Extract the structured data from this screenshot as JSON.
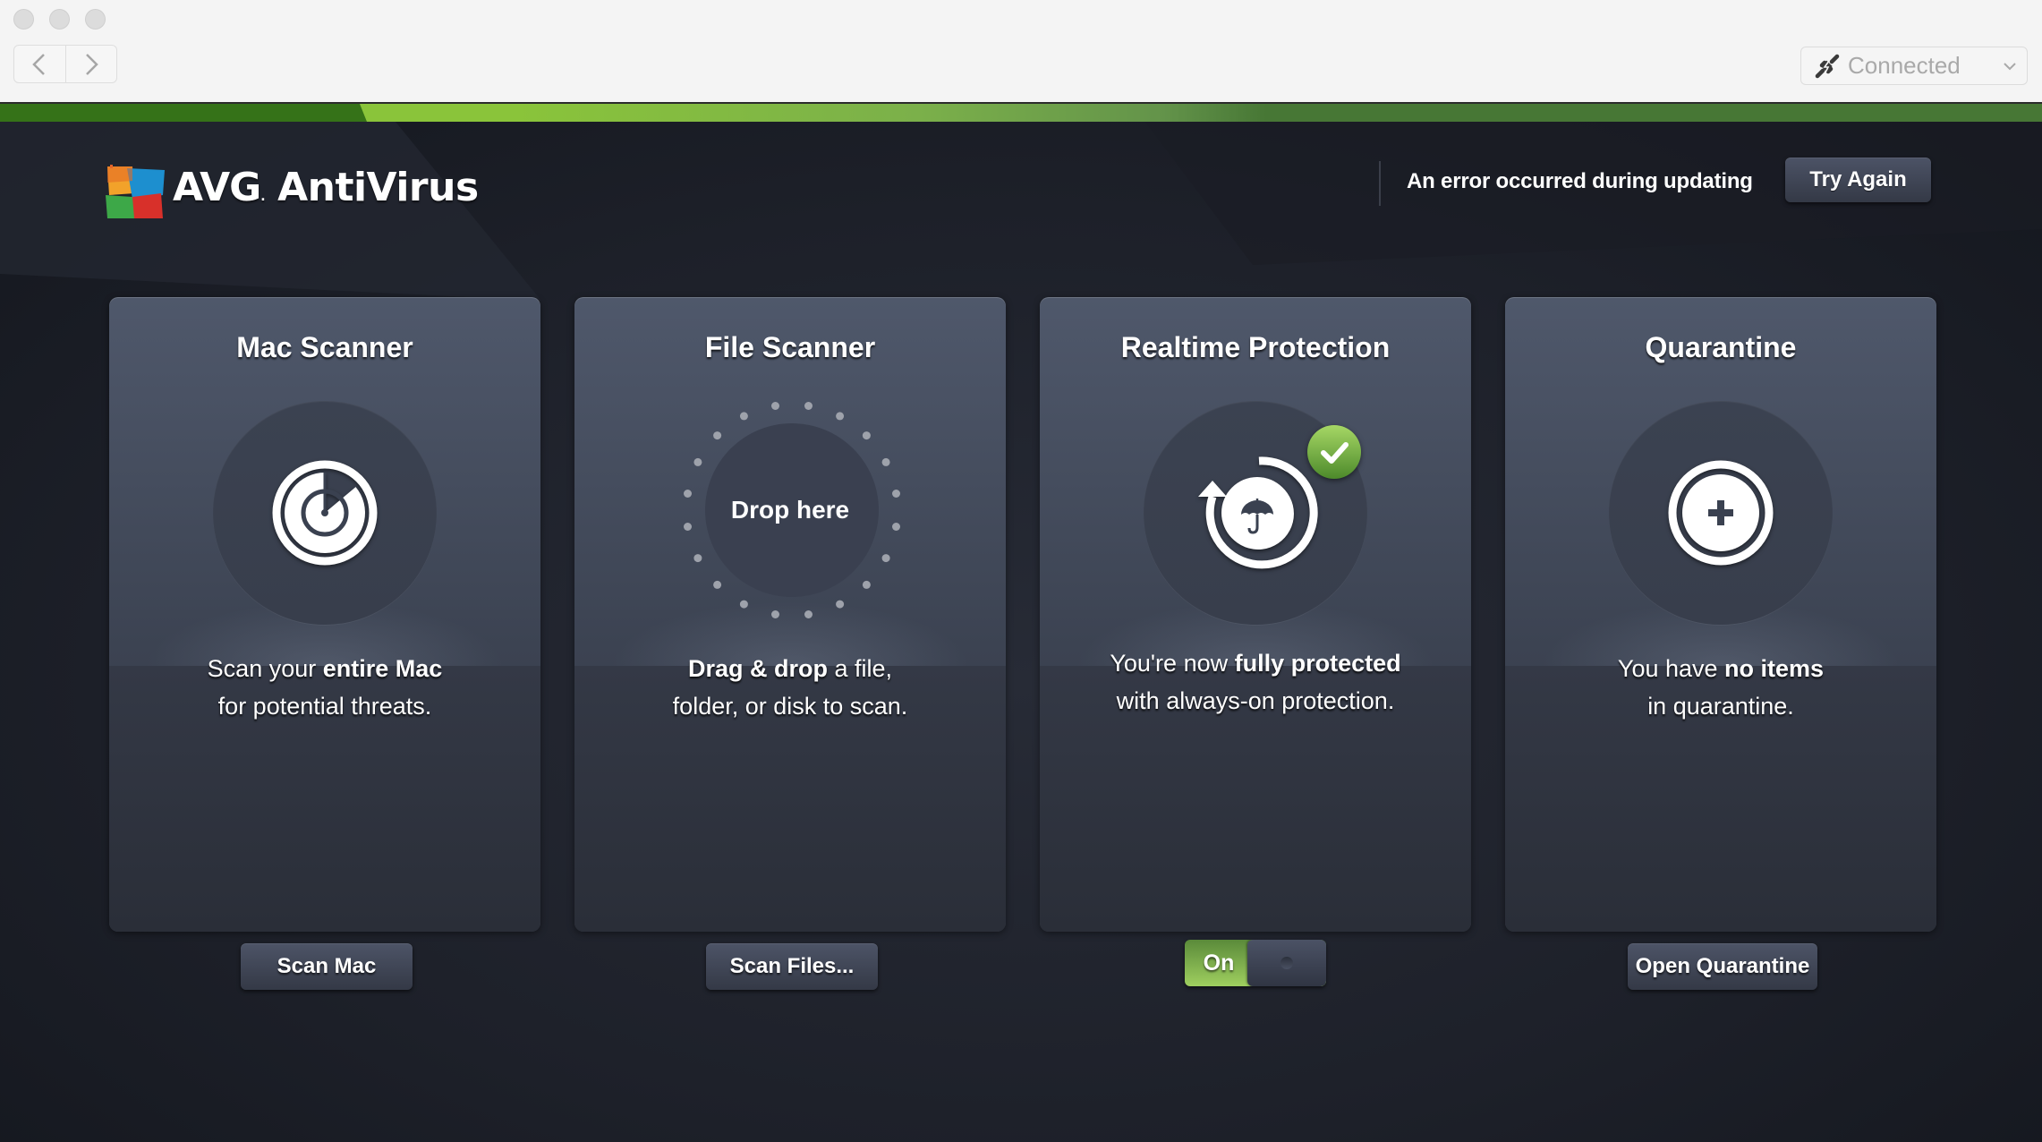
{
  "window": {
    "nav": {
      "back_icon": "chevron-left-icon",
      "forward_icon": "chevron-right-icon"
    },
    "connection": {
      "icon": "plug-icon",
      "label": "Connected",
      "chevron": "chevron-down-icon"
    }
  },
  "header": {
    "brand_avg": "AVG",
    "brand_product": "AntiVirus",
    "update_error": "An error occurred during updating",
    "try_again_label": "Try Again"
  },
  "colors": {
    "accent_green": "#8ac43a",
    "dark_green": "#357218",
    "card_top": "#4f586b",
    "app_bg": "#1d2029"
  },
  "cards": [
    {
      "title": "Mac Scanner",
      "icon": "radar-icon",
      "desc_line1_plain": "Scan your ",
      "desc_line1_bold": "entire Mac",
      "desc_line2": "for potential threats.",
      "button_label": "Scan Mac"
    },
    {
      "title": "File Scanner",
      "icon": "drop-zone-icon",
      "drop_label": "Drop here",
      "desc_line1_bold": "Drag & drop",
      "desc_line1_plain": " a file,",
      "desc_line2": "folder, or disk to scan.",
      "button_label": "Scan Files..."
    },
    {
      "title": "Realtime Protection",
      "icon": "realtime-umbrella-icon",
      "status_badge": "check-icon",
      "desc_line1_plain": "You're now ",
      "desc_line1_bold": "fully protected",
      "desc_line2": "with always-on protection.",
      "toggle_label": "On",
      "toggle_state": true
    },
    {
      "title": "Quarantine",
      "icon": "quarantine-plus-icon",
      "desc_line1_plain": "You have ",
      "desc_line1_bold": "no items",
      "desc_line2": "in quarantine.",
      "button_label": "Open Quarantine"
    }
  ]
}
